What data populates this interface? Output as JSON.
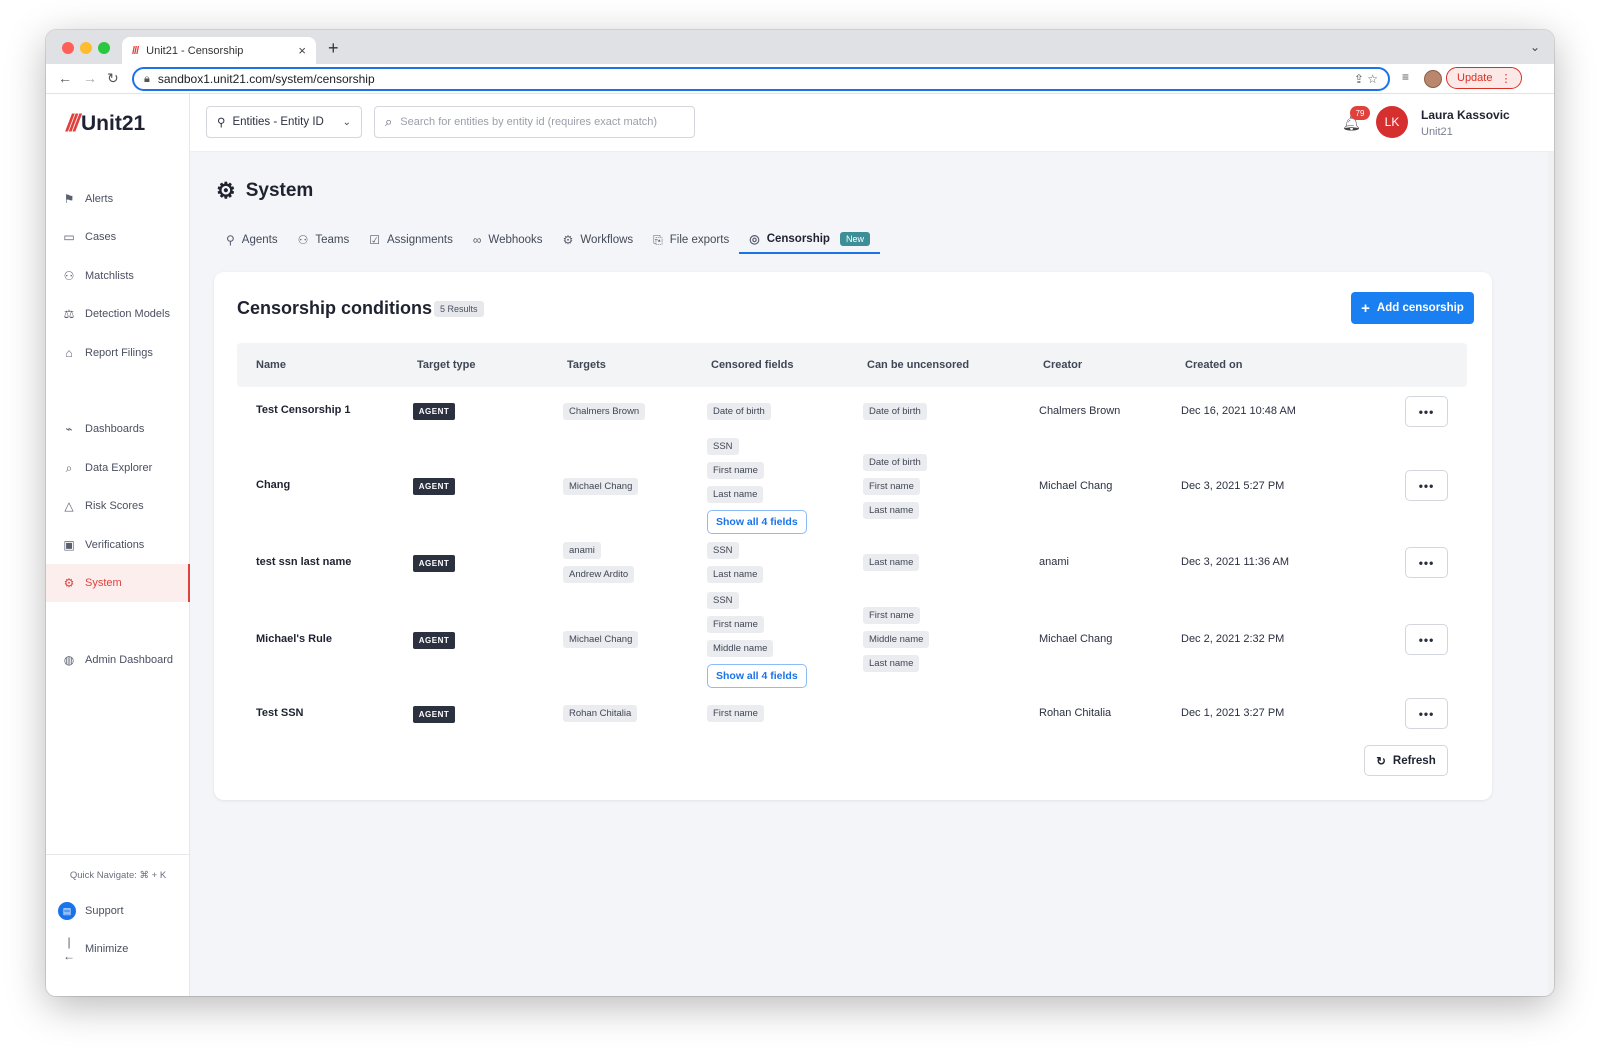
{
  "browser": {
    "tab_title": "Unit21 - Censorship",
    "tab_favicon": "///",
    "tab_close": "×",
    "new_tab": "+",
    "url": "sandbox1.unit21.com/system/censorship",
    "update_label": "Update"
  },
  "sidebar": {
    "logo_mark": "///",
    "logo_text": "Unit21",
    "items": [
      {
        "label": "Alerts",
        "icon": "flag-icon"
      },
      {
        "label": "Cases",
        "icon": "briefcase-icon"
      },
      {
        "label": "Matchlists",
        "icon": "user-list-icon"
      },
      {
        "label": "Detection Models",
        "icon": "scale-icon"
      },
      {
        "label": "Report Filings",
        "icon": "bank-icon"
      },
      {
        "label": "Dashboards",
        "icon": "chart-line-icon"
      },
      {
        "label": "Data Explorer",
        "icon": "data-search-icon"
      },
      {
        "label": "Risk Scores",
        "icon": "warning-icon"
      },
      {
        "label": "Verifications",
        "icon": "id-card-icon"
      },
      {
        "label": "System",
        "icon": "gear-icon",
        "active": true
      },
      {
        "label": "Admin Dashboard",
        "icon": "globe-icon"
      }
    ],
    "quick_navigate": "Quick Navigate: ⌘ + K",
    "support_label": "Support",
    "minimize_label": "Minimize"
  },
  "topbar": {
    "entity_select_value": "Entities - Entity ID",
    "search_placeholder": "Search for entities by entity id (requires exact match)",
    "notification_count": "79",
    "user_initials": "LK",
    "user_name": "Laura Kassovic",
    "user_org": "Unit21"
  },
  "page": {
    "title": "System",
    "tabs": [
      {
        "label": "Agents",
        "icon": "user-icon"
      },
      {
        "label": "Teams",
        "icon": "team-icon"
      },
      {
        "label": "Assignments",
        "icon": "clipboard-icon"
      },
      {
        "label": "Webhooks",
        "icon": "link-icon"
      },
      {
        "label": "Workflows",
        "icon": "cog-icon"
      },
      {
        "label": "File exports",
        "icon": "file-export-icon"
      },
      {
        "label": "Censorship",
        "icon": "censor-icon",
        "active": true,
        "badge": "New"
      }
    ]
  },
  "card": {
    "title": "Censorship conditions",
    "results_badge": "5 Results",
    "add_button": "Add censorship",
    "refresh_button": "Refresh",
    "columns": [
      "Name",
      "Target type",
      "Targets",
      "Censored fields",
      "Can be uncensored",
      "Creator",
      "Created on"
    ],
    "rows": [
      {
        "name": "Test Censorship 1",
        "target_type": "AGENT",
        "targets": [
          "Chalmers Brown"
        ],
        "censored_fields": [
          "Date of birth"
        ],
        "censored_more": "",
        "can_be_uncensored": [
          "Date of birth"
        ],
        "creator": "Chalmers Brown",
        "created_on": "Dec 16, 2021 10:48 AM"
      },
      {
        "name": "Chang",
        "target_type": "AGENT",
        "targets": [
          "Michael Chang"
        ],
        "censored_fields": [
          "SSN",
          "First name",
          "Last name"
        ],
        "censored_more": "Show all 4 fields",
        "can_be_uncensored": [
          "Date of birth",
          "First name",
          "Last name"
        ],
        "creator": "Michael Chang",
        "created_on": "Dec 3, 2021 5:27 PM"
      },
      {
        "name": "test ssn last name",
        "target_type": "AGENT",
        "targets": [
          "anami",
          "Andrew Ardito"
        ],
        "censored_fields": [
          "SSN",
          "Last name"
        ],
        "censored_more": "",
        "can_be_uncensored": [
          "Last name"
        ],
        "creator": "anami",
        "created_on": "Dec 3, 2021 11:36 AM"
      },
      {
        "name": "Michael's Rule",
        "target_type": "AGENT",
        "targets": [
          "Michael Chang"
        ],
        "censored_fields": [
          "SSN",
          "First name",
          "Middle name"
        ],
        "censored_more": "Show all 4 fields",
        "can_be_uncensored": [
          "First name",
          "Middle name",
          "Last name"
        ],
        "creator": "Michael Chang",
        "created_on": "Dec 2, 2021 2:32 PM"
      },
      {
        "name": "Test SSN",
        "target_type": "AGENT",
        "targets": [
          "Rohan Chitalia"
        ],
        "censored_fields": [
          "First name"
        ],
        "censored_more": "",
        "can_be_uncensored": [],
        "creator": "Rohan Chitalia",
        "created_on": "Dec 1, 2021 3:27 PM"
      }
    ]
  },
  "colors": {
    "brand_red": "#e0413c",
    "primary_blue": "#1a7ff0",
    "agent_tag": "#2c3140",
    "new_badge": "#3c8f96"
  }
}
